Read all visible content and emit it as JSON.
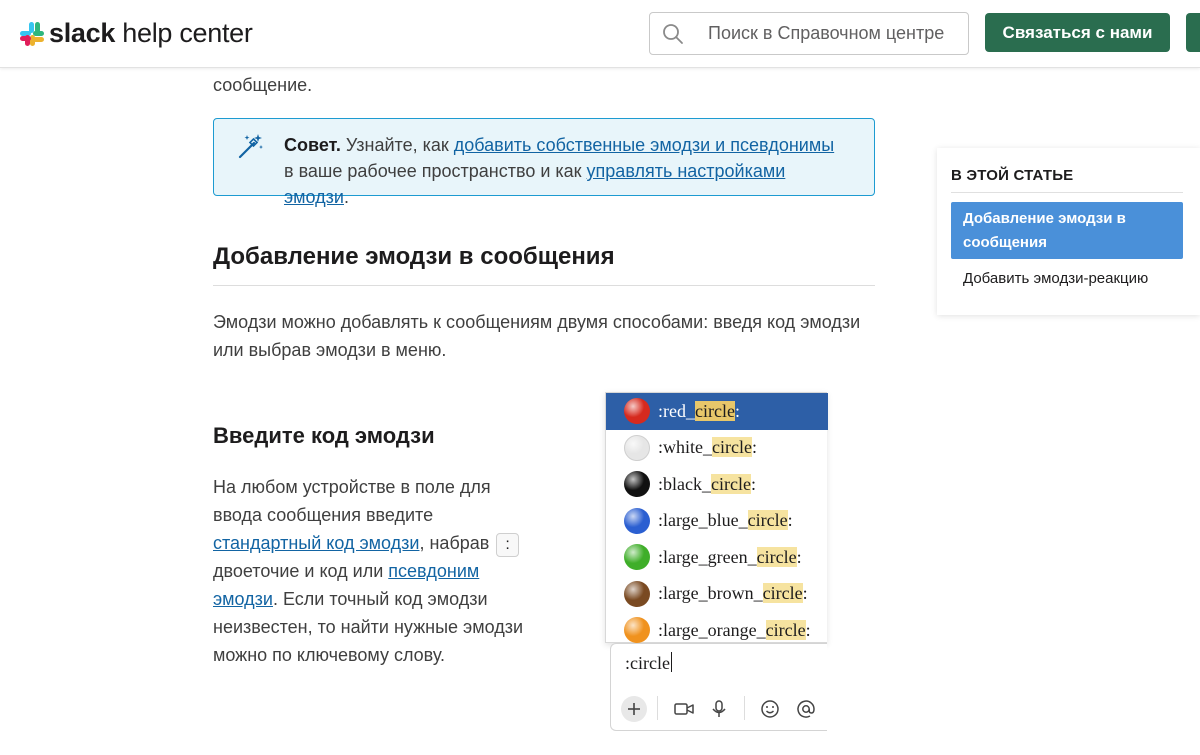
{
  "header": {
    "logo_bold": "slack",
    "logo_rest": " help center",
    "search_placeholder": "Поиск в Справочном центре",
    "contact_button": "Связаться с нами"
  },
  "article": {
    "lead_fragment": "сообщение.",
    "tip": {
      "label": "Совет.",
      "text_1": " Узнайте, как ",
      "link_1": "добавить собственные эмодзи и псевдонимы",
      "text_2": " в ваше рабочее пространство и как ",
      "link_2": "управлять настройками эмодзи",
      "text_3": "."
    },
    "h2": "Добавление эмодзи в сообщения",
    "p1": "Эмодзи можно добавлять к сообщениям двумя способами: введя код эмодзи или выбрав эмодзи в меню.",
    "h3": "Введите код эмодзи",
    "p2": {
      "t1": "На любом устройстве в поле для ввода сообщения введите ",
      "link1": "стандартный код эмодзи",
      "t2": ", набрав ",
      "kbd": ":",
      "t3": " двоеточие и код или ",
      "link2": "псевдоним эмодзи",
      "t4": ". Если точный код эмодзи неизвестен, то найти нужные эмодзи можно по ключевому слову."
    }
  },
  "picker": {
    "highlight": "circle",
    "rows": [
      {
        "pre": ":red_",
        "post": ":",
        "color": "#d62a1e",
        "selected": true
      },
      {
        "pre": ":white_",
        "post": ":",
        "color": "#e6e6e6",
        "selected": false
      },
      {
        "pre": ":black_",
        "post": ":",
        "color": "#111111",
        "selected": false
      },
      {
        "pre": ":large_blue_",
        "post": ":",
        "color": "#2b5fd1",
        "selected": false
      },
      {
        "pre": ":large_green_",
        "post": ":",
        "color": "#3fae29",
        "selected": false
      },
      {
        "pre": ":large_brown_",
        "post": ":",
        "color": "#7a4a22",
        "selected": false
      },
      {
        "pre": ":large_orange_",
        "post": ":",
        "color": "#f0921e",
        "selected": false
      }
    ],
    "typed": ":circle"
  },
  "toc": {
    "title": "В ЭТОЙ СТАТЬЕ",
    "active": "Добавление эмодзи в сообщения",
    "item": "Добавить эмодзи-реакцию"
  },
  "colors": {
    "brand_green": "#2a6d4f",
    "link": "#1264a3",
    "tip_bg": "#e8f5fa",
    "toc_active": "#4a90d9"
  }
}
